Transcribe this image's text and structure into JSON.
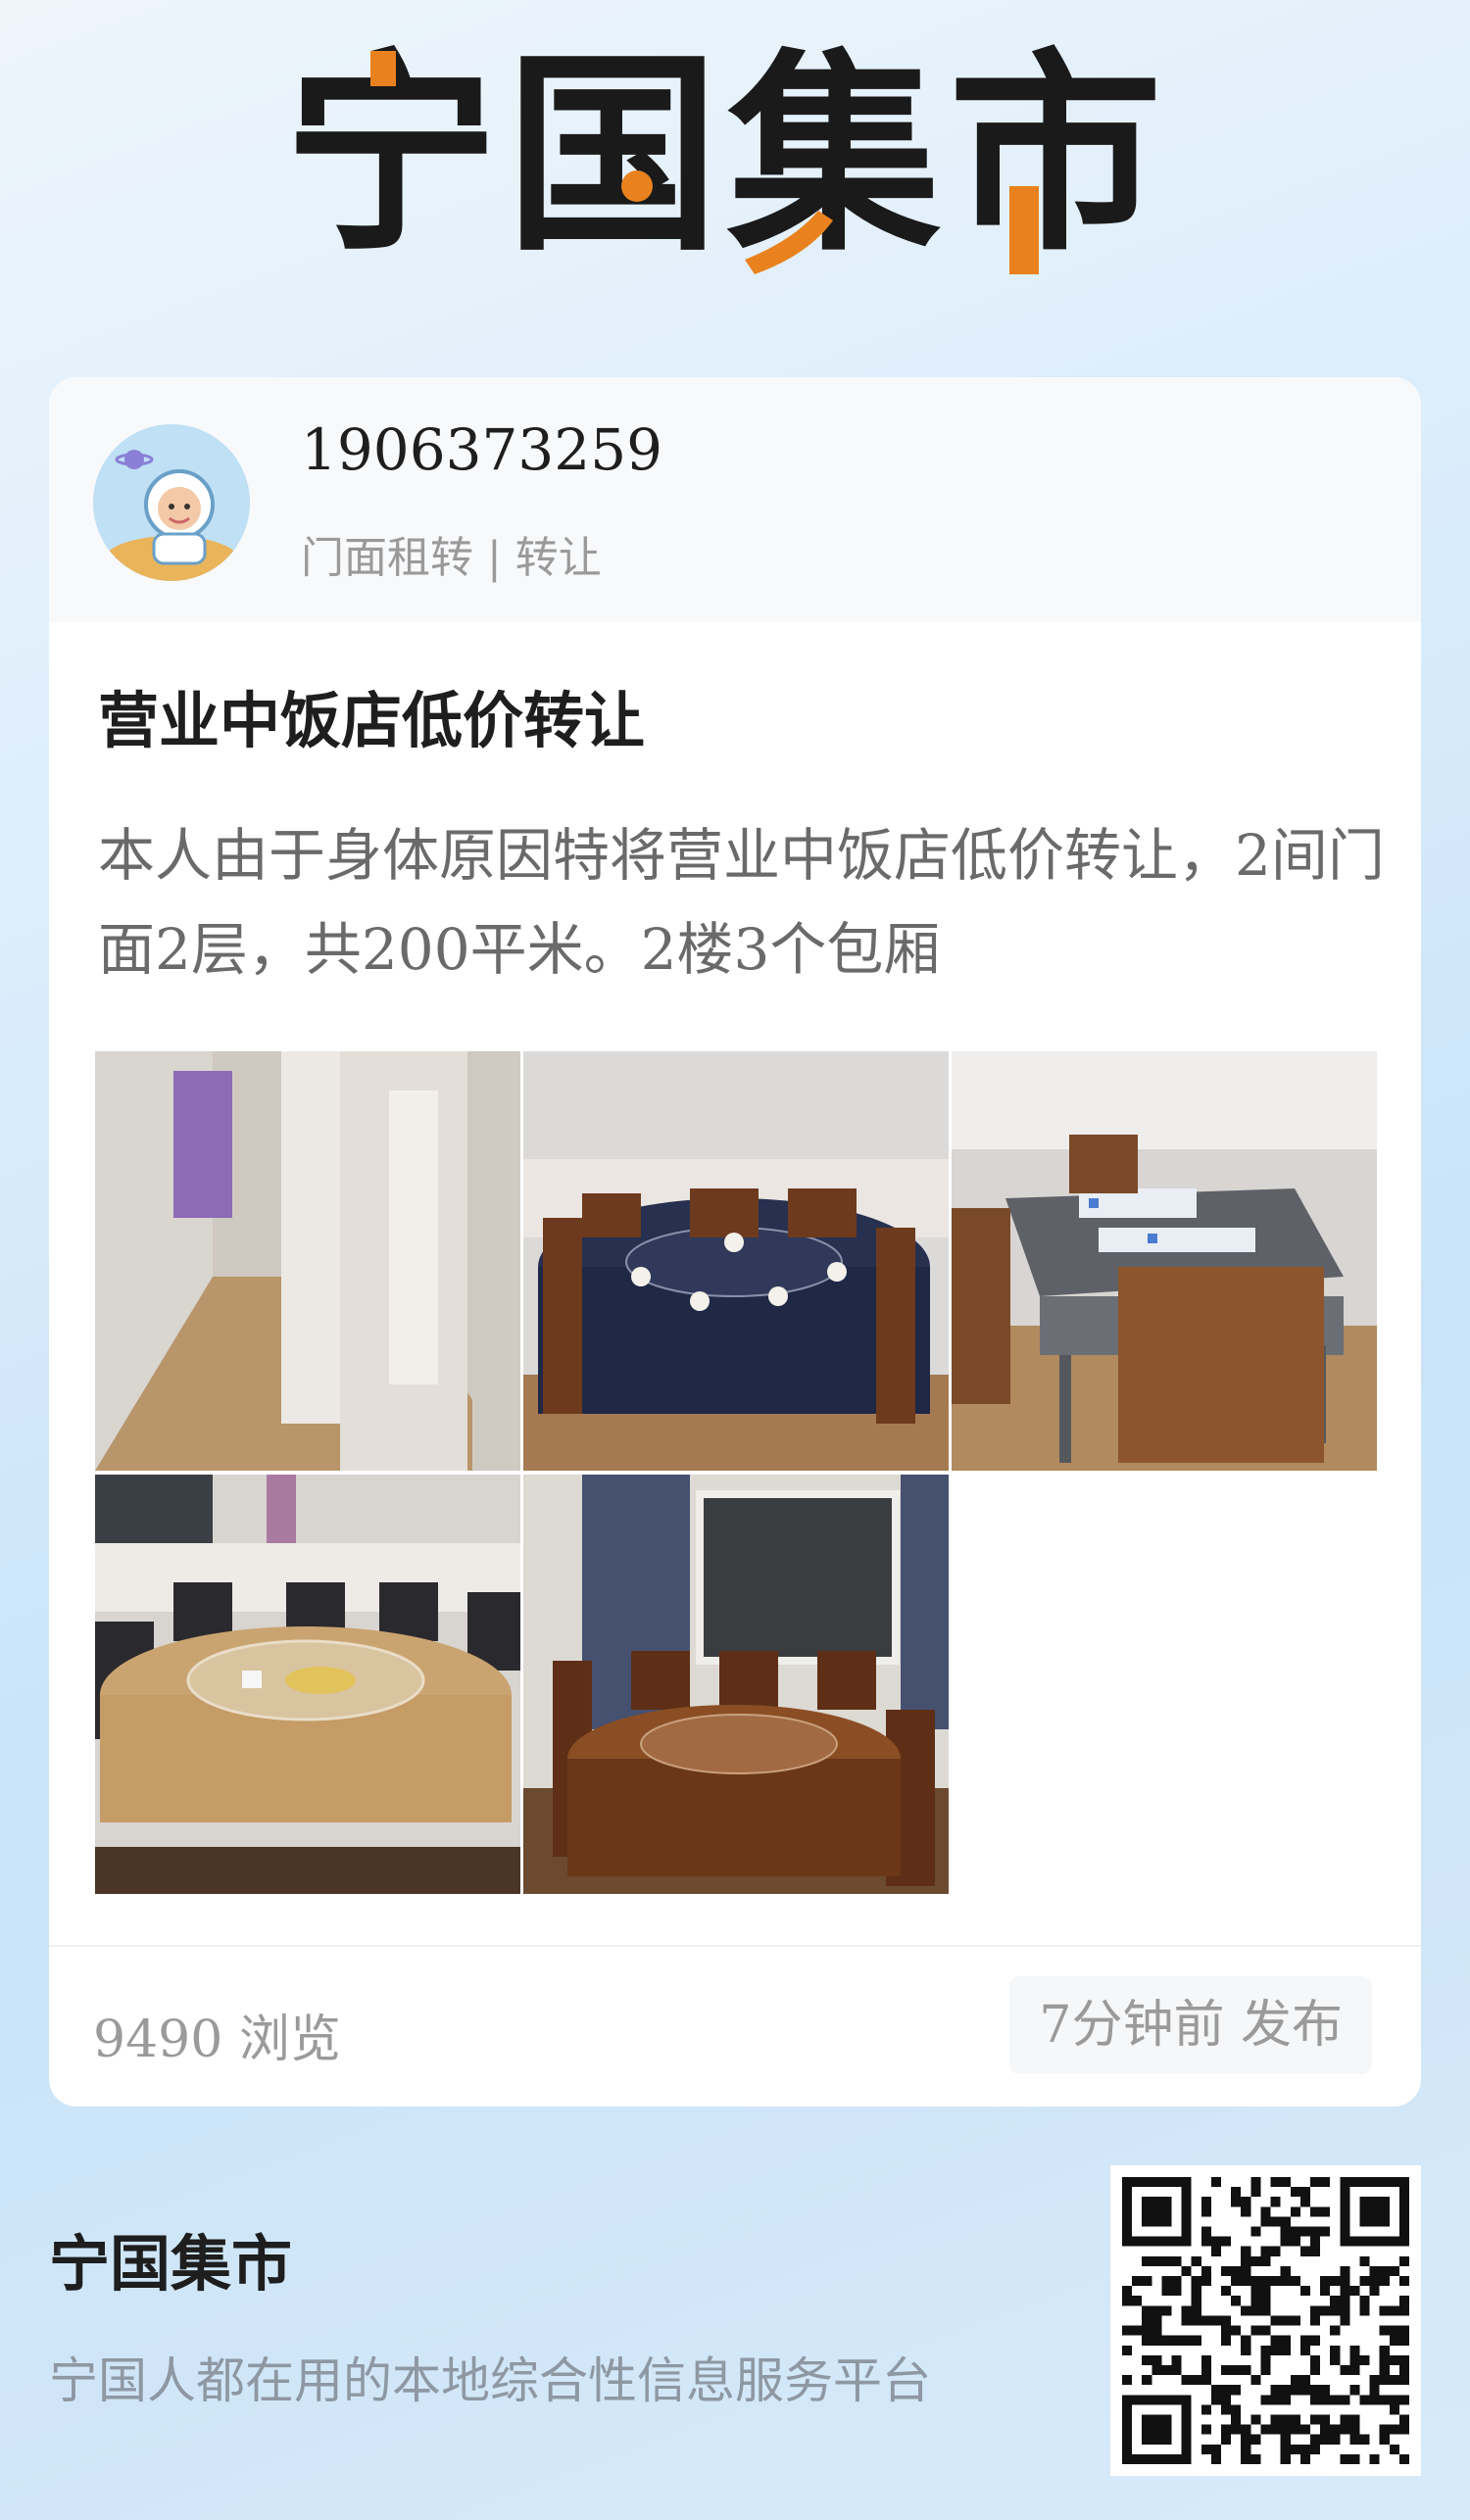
{
  "header": {
    "logo_chars": [
      "宁",
      "国",
      "集",
      "市"
    ],
    "accent_color": "#e9821e",
    "text_color": "#1a1a1a"
  },
  "card": {
    "user": {
      "phone": "1906373259",
      "category": "门面租转 | 转让"
    },
    "title": "营业中饭店低价转让",
    "body": "本人由于身体原因特将营业中饭店低价转让，2间门面2层，共200平米。2楼3个包厢",
    "photos": [
      {
        "desc": "hallway-photo"
      },
      {
        "desc": "round-table-blue-cloth-photo"
      },
      {
        "desc": "mahjong-table-photo"
      },
      {
        "desc": "round-table-gold-cloth-photo"
      },
      {
        "desc": "round-table-wood-photo"
      }
    ],
    "views": "9490 浏览",
    "posted": "7分钟前 发布"
  },
  "footer": {
    "brand": "宁国集市",
    "tagline": "宁国人都在用的本地综合性信息服务平台"
  }
}
